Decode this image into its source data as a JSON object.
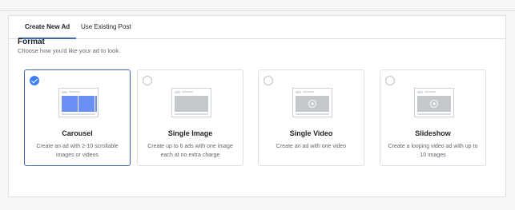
{
  "tabs": [
    {
      "label": "Create New Ad",
      "active": true
    },
    {
      "label": "Use Existing Post",
      "active": false
    }
  ],
  "format": {
    "title": "Format",
    "subtitle": "Choose how you'd like your ad to look."
  },
  "cards": [
    {
      "title": "Carousel",
      "description": "Create an ad with 2-10 scrollable images or videos",
      "selected": true,
      "icon": "carousel-preview-icon"
    },
    {
      "title": "Single Image",
      "description": "Create up to 6 ads with one image each at no extra charge",
      "selected": false,
      "icon": "single-image-preview-icon"
    },
    {
      "title": "Single Video",
      "description": "Create an ad with one video",
      "selected": false,
      "icon": "single-video-preview-icon"
    },
    {
      "title": "Slideshow",
      "description": "Create a looping video ad with up to 10 images",
      "selected": false,
      "icon": "slideshow-preview-icon"
    }
  ],
  "colors": {
    "accent": "#4267b2",
    "selected_check": "#4080ff"
  }
}
